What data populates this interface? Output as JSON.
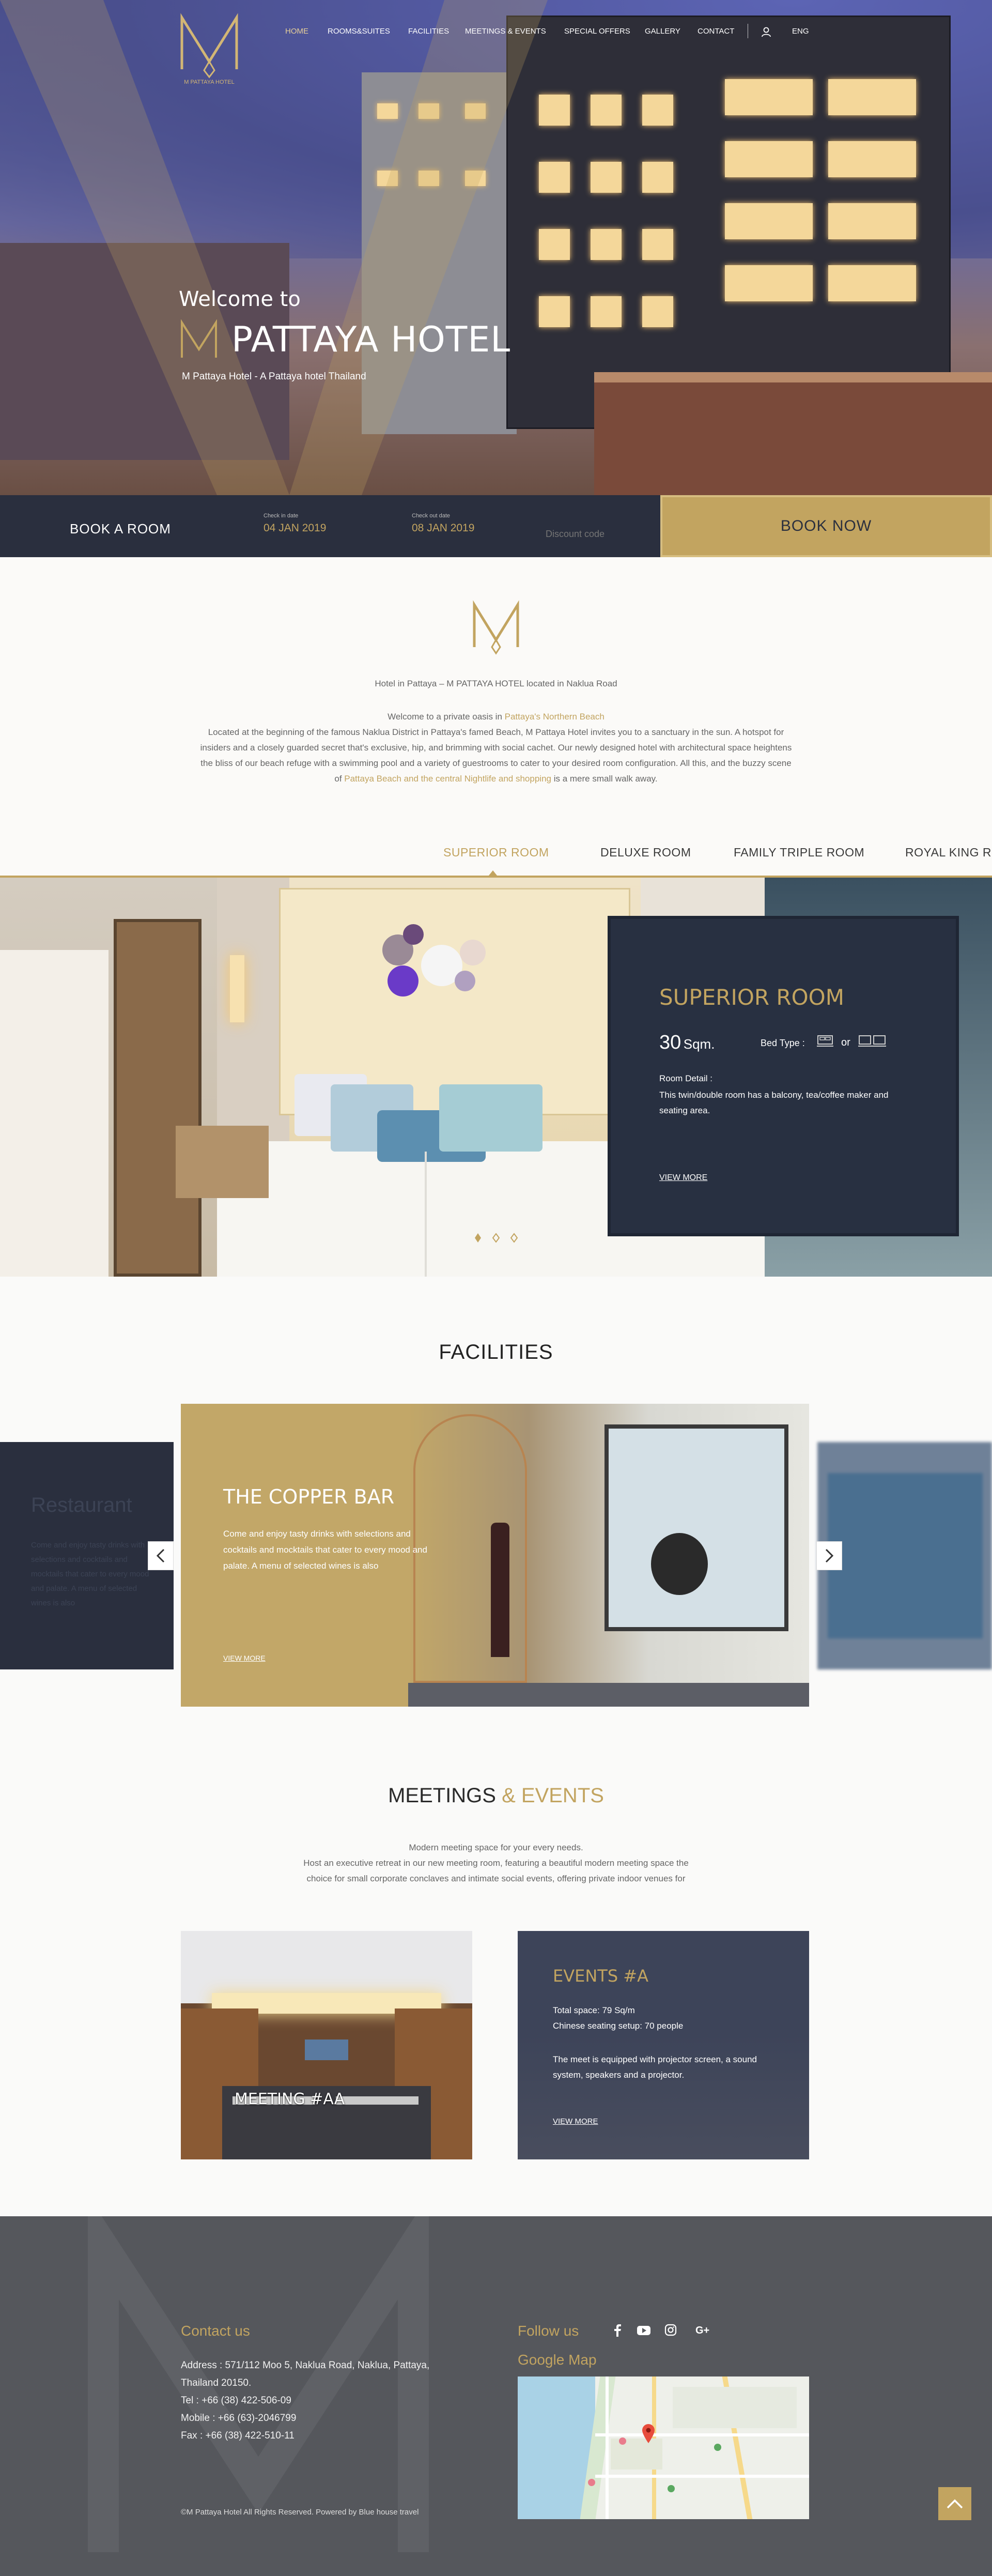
{
  "brand": {
    "logo_text": "M PATTAYA HOTEL",
    "accent": "#c2a460",
    "navy": "#2a2f3e"
  },
  "nav": {
    "items": [
      "HOME",
      "ROOMS&SUITES",
      "FACILITIES",
      "MEETINGS & EVENTS",
      "SPECIAL OFFERS",
      "GALLERY",
      "CONTACT"
    ],
    "user_icon": "user-icon",
    "language": "ENG"
  },
  "hero": {
    "welcome": "Welcome to",
    "hotel_name": "PATTAYA HOTEL",
    "tagline": "M Pattaya Hotel - A Pattaya hotel Thailand"
  },
  "booking": {
    "book_room": "BOOK A ROOM",
    "checkin_label": "Check in date",
    "checkin_value": "04 JAN  2019",
    "checkout_label": "Check out date",
    "checkout_value": "08 JAN  2019",
    "promo_placeholder": "Discount code",
    "book_now": "BOOK NOW"
  },
  "intro": {
    "subtitle": "Hotel in Pattaya – M PATTAYA HOTEL located in Naklua Road",
    "welcome_prefix": "Welcome to a private oasis in ",
    "welcome_link": "Pattaya's Northern Beach",
    "line1": "Located at the beginning of the famous Naklua District in Pattaya's famed Beach, M Pattaya Hotel invites you to a sanctuary in the sun. A hotspot for",
    "line2": "insiders and a closely guarded secret that's exclusive, hip, and brimming with social cachet. Our newly designed hotel with architectural space heightens",
    "line3": "the bliss of our beach refuge with a swimming pool and a variety of guestrooms to cater to your desired room configuration. All this, and the buzzy scene",
    "line4_prefix": "of ",
    "line4_link": "Pattaya Beach and the central Nightlife and shopping",
    "line4_suffix": " is a mere small walk away."
  },
  "rooms": {
    "tabs": [
      "SUPERIOR ROOM",
      "DELUXE ROOM",
      "FAMILY TRIPLE ROOM",
      "ROYAL KING RO"
    ],
    "active_tab": 0,
    "card": {
      "title": "SUPERIOR ROOM",
      "size_num": "30",
      "size_unit": "Sqm.",
      "bed_type_label": "Bed Type :",
      "bed_or": "or",
      "detail_label": "Room Detail :",
      "detail": "This twin/double room has a balcony, tea/coffee maker and seating area.",
      "view_more": "VIEW MORE"
    },
    "slide_count": 3,
    "active_slide": 0
  },
  "facilities": {
    "title": "FACILITIES",
    "left_title": "Restaurant",
    "left_text": "Come and enjoy tasty drinks with selections and cocktails and mocktails that cater to every mood and palate. A menu of selected wines is also",
    "main_title": "THE COPPER BAR",
    "main_text": "Come and enjoy tasty drinks with selections and cocktails and mocktails that cater to every mood and palate. A menu of selected wines is also",
    "view_more": "VIEW MORE",
    "prev_icon": "chevron-left-icon",
    "next_icon": "chevron-right-icon"
  },
  "meetings": {
    "title_a": "MEETINGS",
    "title_amp": "& EVENTS",
    "line1": "Modern meeting space for your every needs.",
    "line2": "Host an executive retreat in our new meeting room, featuring a beautiful modern meeting space the",
    "line3": "choice for small corporate conclaves and intimate social events, offering private indoor venues for",
    "room_label": "MEETING #AA",
    "event": {
      "title": "EVENTS #A",
      "total_space": "Total space: 79 Sq/m",
      "seating": "Chinese seating setup: 70 people",
      "desc": "The meet is equipped with projector screen, a sound system, speakers and a projector.",
      "view_more": "VIEW MORE"
    }
  },
  "footer": {
    "contact_title": "Contact us",
    "address": "Address : 571/112 Moo 5, Naklua Road, Naklua, Pattaya,",
    "address2": "Thailand 20150.",
    "tel": "Tel : +66 (38) 422-506-09",
    "mobile": "Mobile : +66 (63)-2046799",
    "fax": "Fax : +66 (38) 422-510-11",
    "follow_title": "Follow us",
    "social_icons": [
      "facebook-icon",
      "youtube-icon",
      "instagram-icon",
      "google-plus-icon"
    ],
    "map_title": "Google Map",
    "copyright": "©M Pattaya Hotel All Rights Reserved. Powered by Blue house travel",
    "to_top_icon": "chevron-up-icon"
  }
}
